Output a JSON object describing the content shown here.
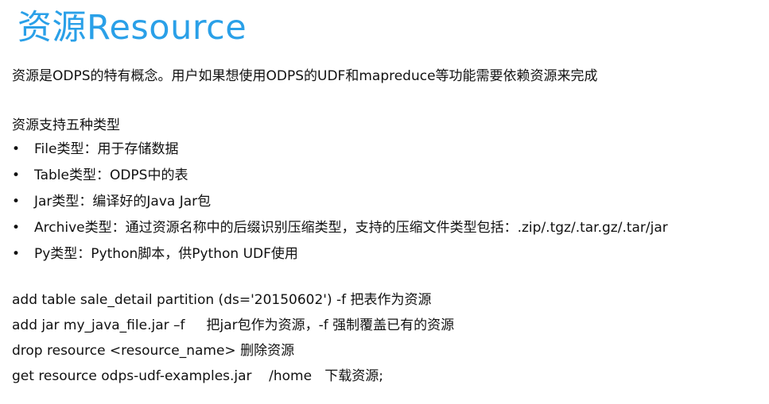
{
  "title": "资源Resource",
  "intro": "资源是ODPS的特有概念。用户如果想使用ODPS的UDF和mapreduce等功能需要依赖资源来完成",
  "types_heading": "资源支持五种类型",
  "bullet_glyph": "•",
  "types": [
    "File类型：用于存储数据",
    "Table类型：ODPS中的表",
    "Jar类型：编译好的Java Jar包",
    "Archive类型：通过资源名称中的后缀识别压缩类型，支持的压缩文件类型包括：.zip/.tgz/.tar.gz/.tar/jar",
    "Py类型：Python脚本，供Python UDF使用"
  ],
  "commands": [
    "add table sale_detail partition (ds='20150602') -f 把表作为资源",
    "add jar my_java_file.jar –f     把jar包作为资源，-f 强制覆盖已有的资源",
    "drop resource <resource_name> 删除资源",
    "get resource odps-udf-examples.jar    /home   下载资源;"
  ],
  "colors": {
    "title": "#2aa0e8",
    "text": "#111111",
    "background": "#ffffff"
  }
}
